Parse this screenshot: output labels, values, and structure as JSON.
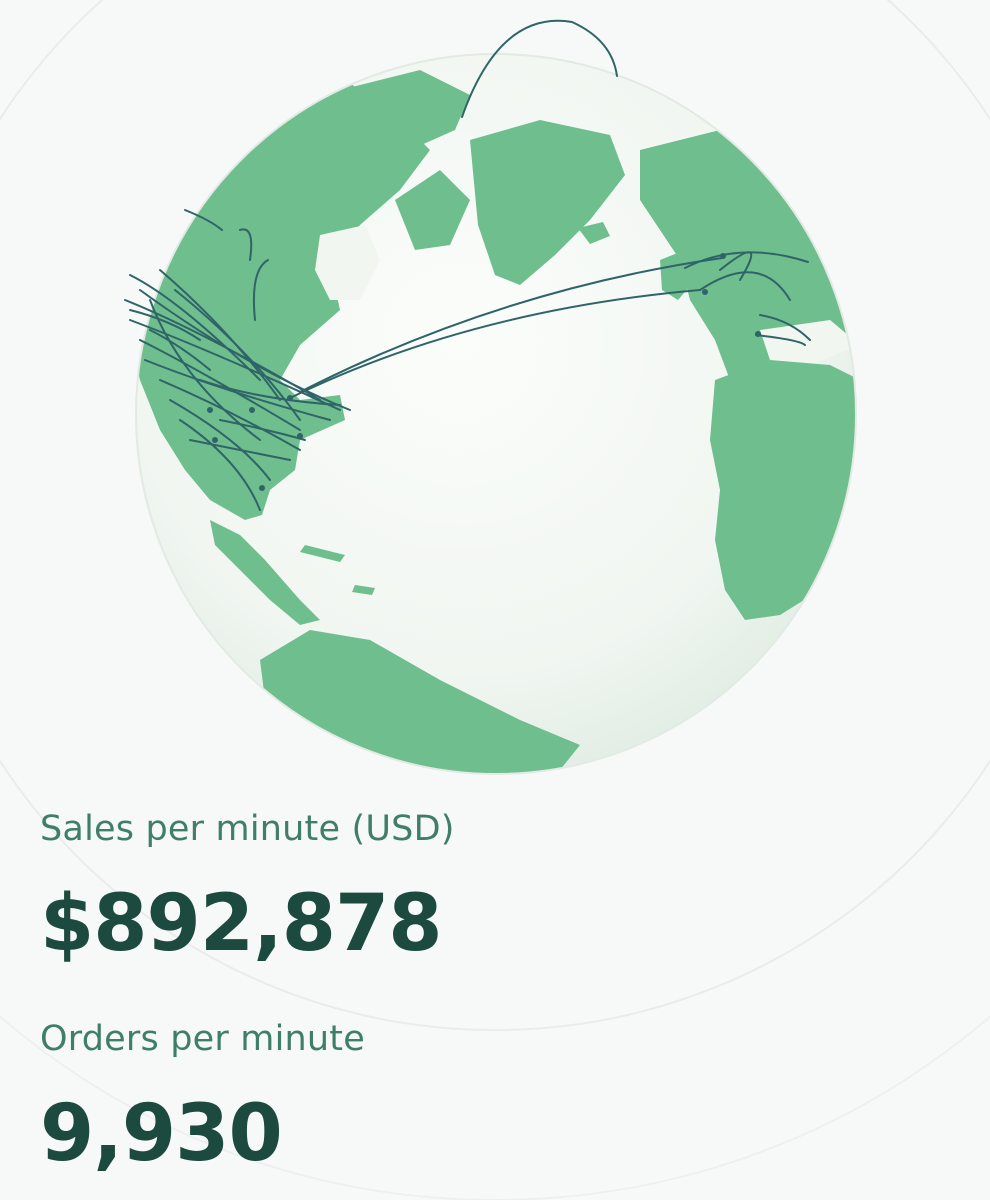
{
  "metrics": {
    "sales": {
      "label": "Sales per minute (USD)",
      "value": "$892,878"
    },
    "orders": {
      "label": "Orders per minute",
      "value": "9,930"
    }
  },
  "colors": {
    "background": "#f7f8f8",
    "land": "#6fbe8d",
    "ocean": "#f3f7f3",
    "arcs": "#2f6468",
    "label": "#3f7f6a",
    "value": "#1d4a3e"
  }
}
